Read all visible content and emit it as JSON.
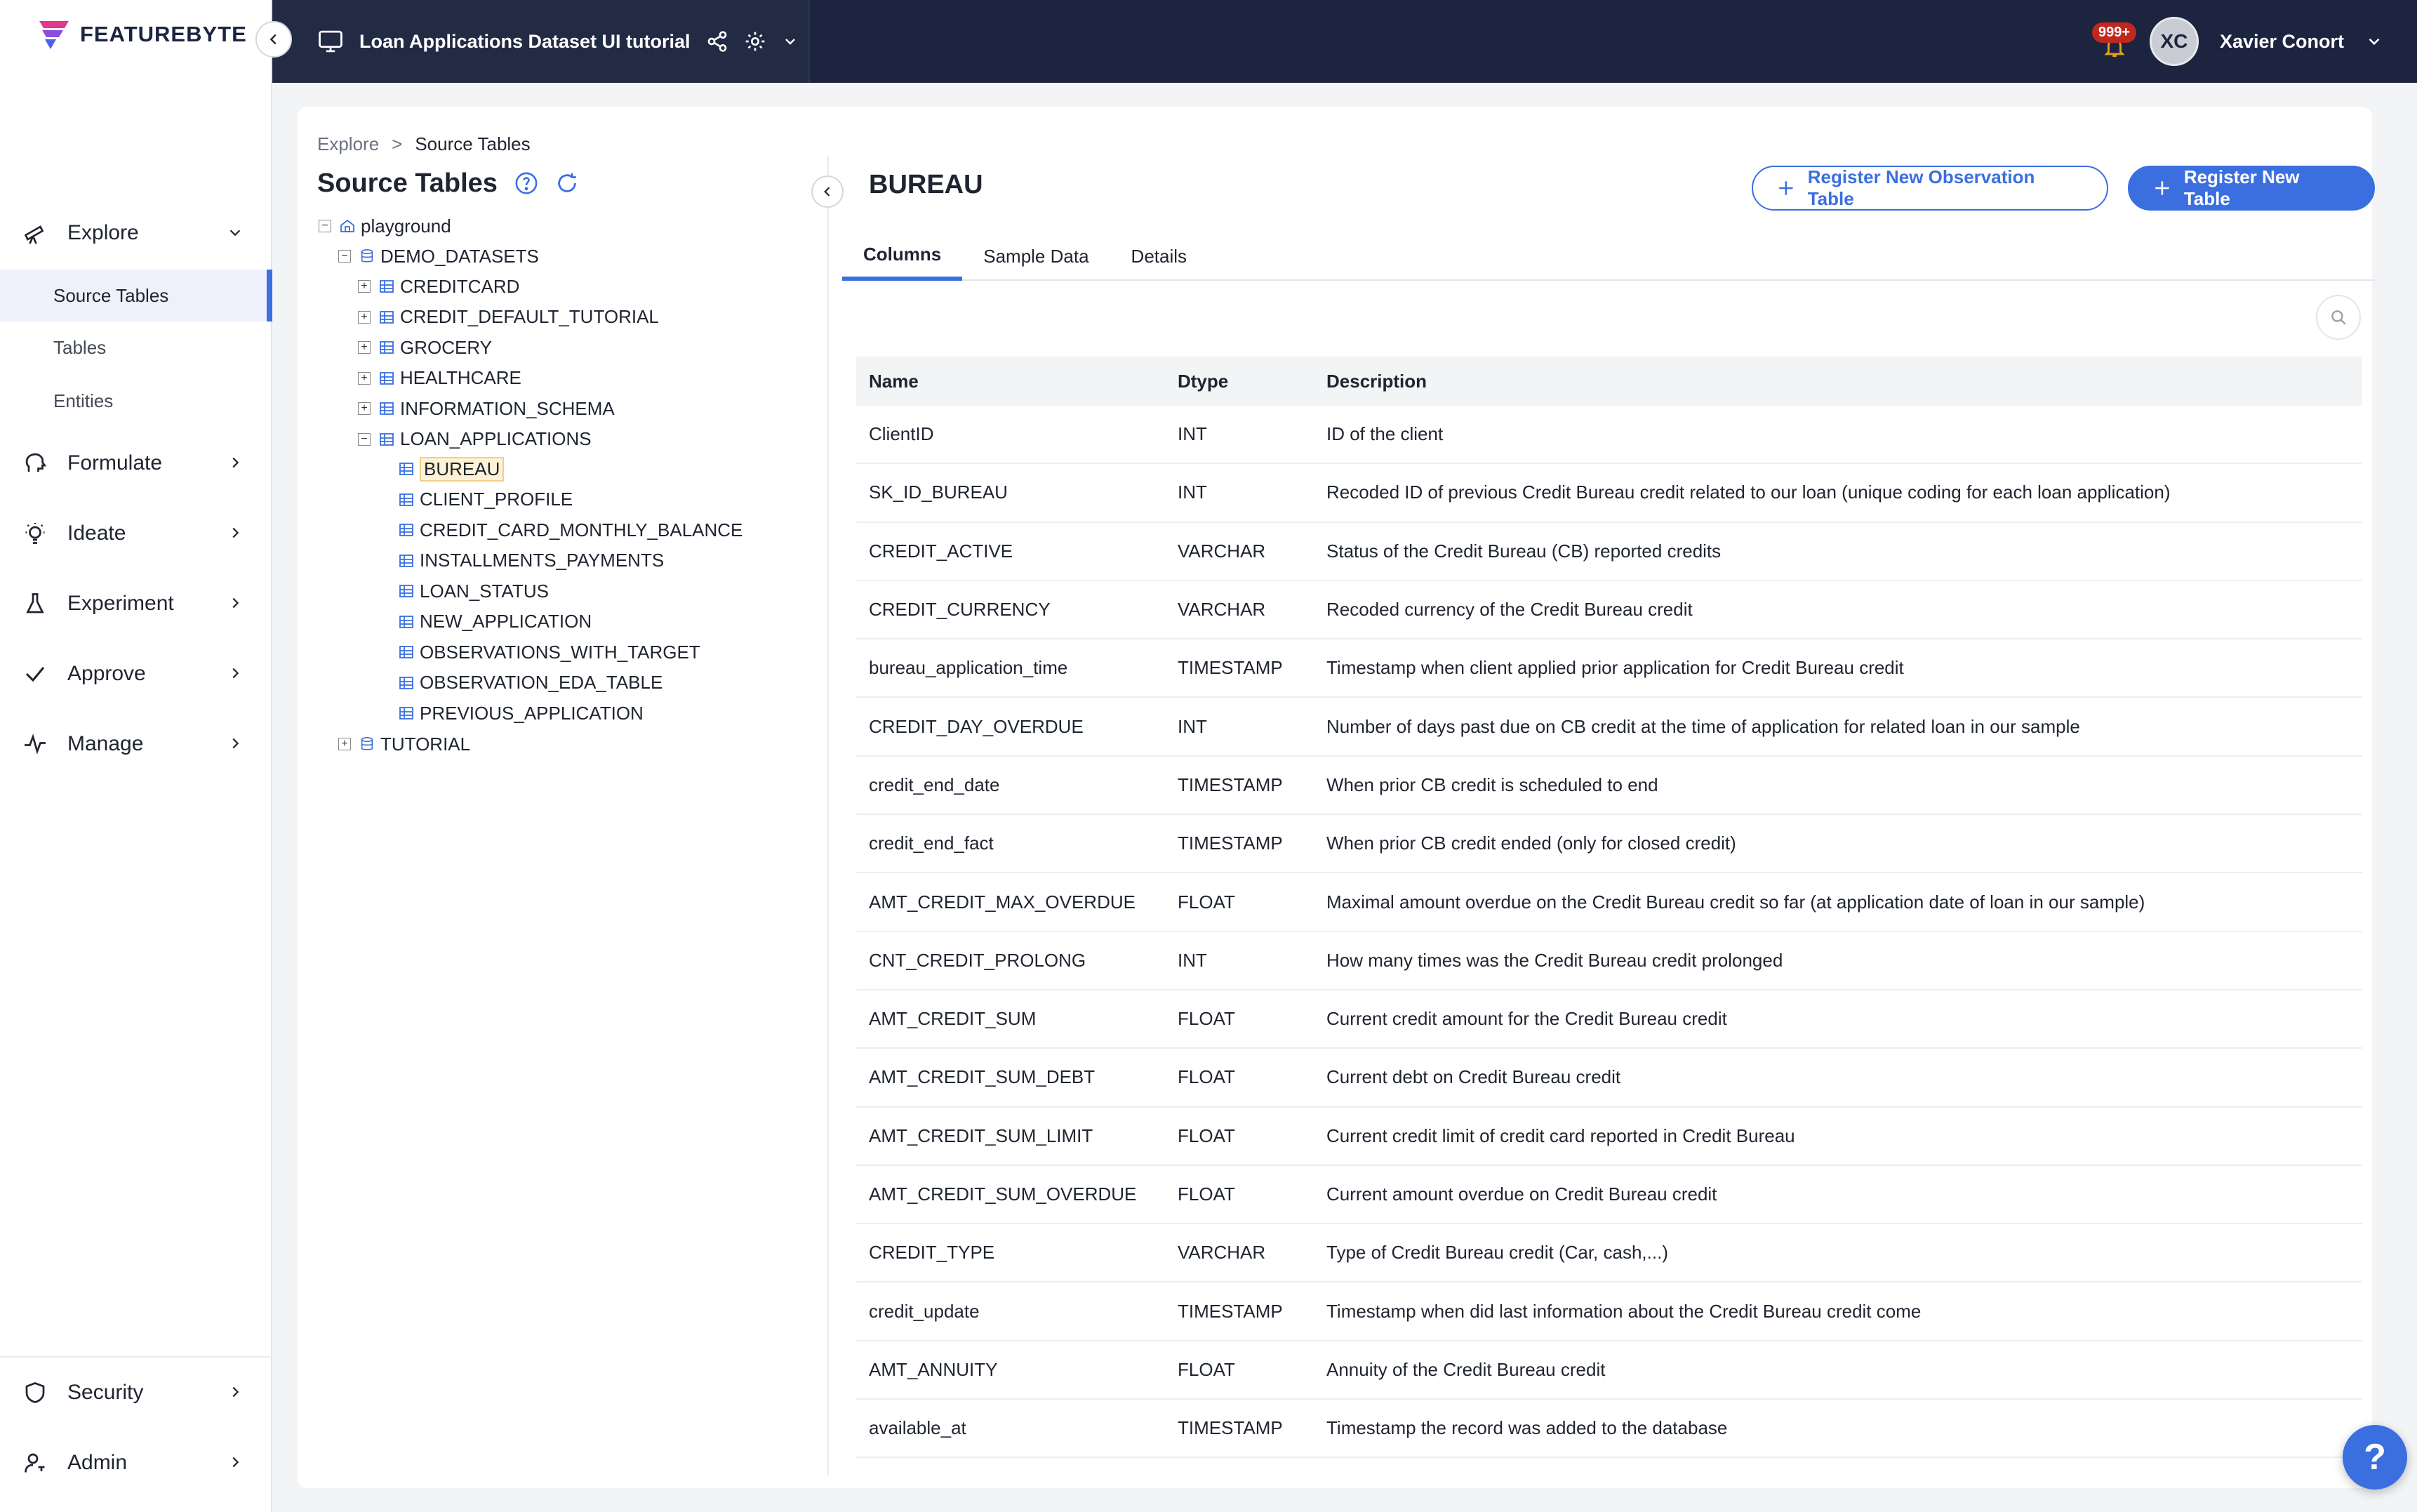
{
  "brand": {
    "logo_text": "FEATUREBYTE",
    "accent": "#3b6fe0"
  },
  "topbar": {
    "project_title": "Loan Applications Dataset UI tutorial",
    "notification_count": "999+",
    "avatar_initials": "XC",
    "user_name": "Xavier Conort"
  },
  "sidebar": {
    "explore": "Explore",
    "sub_items": [
      "Source Tables",
      "Tables",
      "Entities"
    ],
    "formulate": "Formulate",
    "ideate": "Ideate",
    "experiment": "Experiment",
    "approve": "Approve",
    "manage": "Manage",
    "security": "Security",
    "admin": "Admin"
  },
  "left_panel": {
    "breadcrumb": [
      "Explore",
      ">",
      "Source Tables"
    ],
    "title": "Source Tables",
    "tree": {
      "root": "playground",
      "db1": "DEMO_DATASETS",
      "schemas": [
        "CREDITCARD",
        "CREDIT_DEFAULT_TUTORIAL",
        "GROCERY",
        "HEALTHCARE",
        "INFORMATION_SCHEMA",
        "LOAN_APPLICATIONS"
      ],
      "tables": [
        "BUREAU",
        "CLIENT_PROFILE",
        "CREDIT_CARD_MONTHLY_BALANCE",
        "INSTALLMENTS_PAYMENTS",
        "LOAN_STATUS",
        "NEW_APPLICATION",
        "OBSERVATIONS_WITH_TARGET",
        "OBSERVATION_EDA_TABLE",
        "PREVIOUS_APPLICATION"
      ],
      "db2": "TUTORIAL"
    }
  },
  "detail": {
    "title": "BUREAU",
    "btn_observation": "Register New Observation Table",
    "btn_table": "Register New Table",
    "tabs": [
      "Columns",
      "Sample Data",
      "Details"
    ],
    "columns_header": {
      "name": "Name",
      "dtype": "Dtype",
      "description": "Description"
    },
    "rows": [
      {
        "name": "ClientID",
        "dtype": "INT",
        "desc": "ID of the client"
      },
      {
        "name": "SK_ID_BUREAU",
        "dtype": "INT",
        "desc": "Recoded ID of previous Credit Bureau credit related to our loan (unique coding for each loan application)"
      },
      {
        "name": "CREDIT_ACTIVE",
        "dtype": "VARCHAR",
        "desc": "Status of the Credit Bureau (CB) reported credits"
      },
      {
        "name": "CREDIT_CURRENCY",
        "dtype": "VARCHAR",
        "desc": "Recoded currency of the Credit Bureau credit"
      },
      {
        "name": "bureau_application_time",
        "dtype": "TIMESTAMP",
        "desc": "Timestamp when client applied prior application for Credit Bureau credit"
      },
      {
        "name": "CREDIT_DAY_OVERDUE",
        "dtype": "INT",
        "desc": "Number of days past due on CB credit at the time of application for related loan in our sample"
      },
      {
        "name": "credit_end_date",
        "dtype": "TIMESTAMP",
        "desc": "When prior CB credit is scheduled to end"
      },
      {
        "name": "credit_end_fact",
        "dtype": "TIMESTAMP",
        "desc": "When prior CB credit ended (only for closed credit)"
      },
      {
        "name": "AMT_CREDIT_MAX_OVERDUE",
        "dtype": "FLOAT",
        "desc": "Maximal amount overdue on the Credit Bureau credit so far (at application date of loan in our sample)"
      },
      {
        "name": "CNT_CREDIT_PROLONG",
        "dtype": "INT",
        "desc": "How many times was the Credit Bureau credit prolonged"
      },
      {
        "name": "AMT_CREDIT_SUM",
        "dtype": "FLOAT",
        "desc": "Current credit amount for the Credit Bureau credit"
      },
      {
        "name": "AMT_CREDIT_SUM_DEBT",
        "dtype": "FLOAT",
        "desc": "Current debt on Credit Bureau credit"
      },
      {
        "name": "AMT_CREDIT_SUM_LIMIT",
        "dtype": "FLOAT",
        "desc": "Current credit limit of credit card reported in Credit Bureau"
      },
      {
        "name": "AMT_CREDIT_SUM_OVERDUE",
        "dtype": "FLOAT",
        "desc": "Current amount overdue on Credit Bureau credit"
      },
      {
        "name": "CREDIT_TYPE",
        "dtype": "VARCHAR",
        "desc": "Type of Credit Bureau credit (Car, cash,...)"
      },
      {
        "name": "credit_update",
        "dtype": "TIMESTAMP",
        "desc": "Timestamp when did last information about the Credit Bureau credit come"
      },
      {
        "name": "AMT_ANNUITY",
        "dtype": "FLOAT",
        "desc": "Annuity of the Credit Bureau credit"
      },
      {
        "name": "available_at",
        "dtype": "TIMESTAMP",
        "desc": "Timestamp the record was added to the database"
      }
    ]
  },
  "help": {
    "label": "?"
  }
}
